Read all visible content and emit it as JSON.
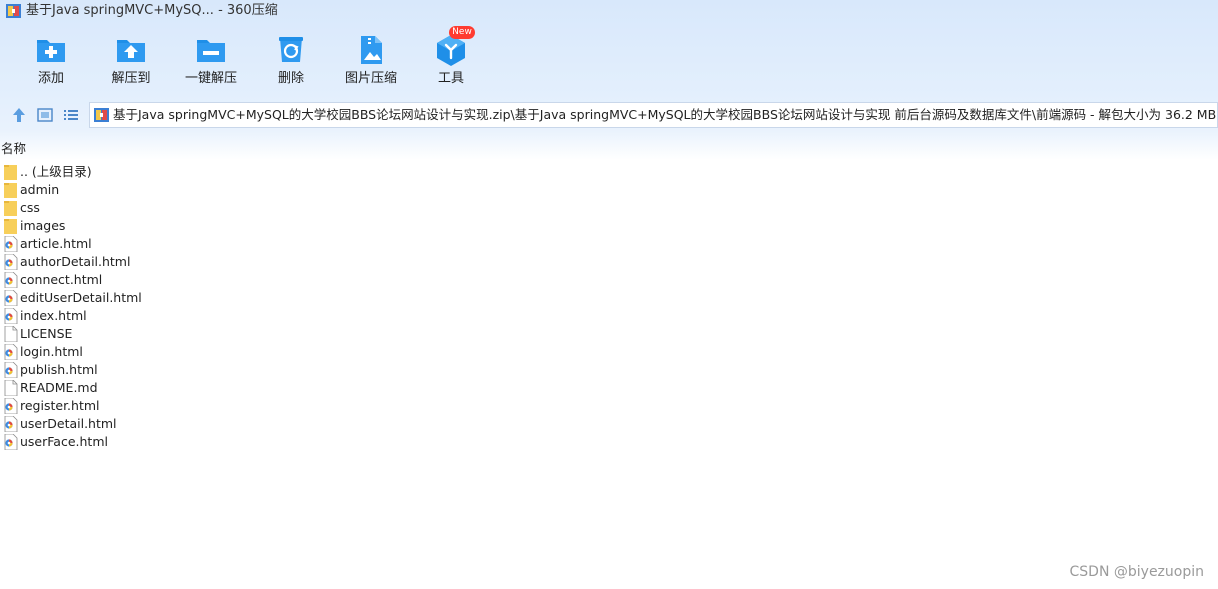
{
  "window": {
    "title": "基于Java springMVC+MySQ... - 360压缩"
  },
  "toolbar": {
    "items": [
      {
        "label": "添加",
        "icon": "add-folder-icon"
      },
      {
        "label": "解压到",
        "icon": "extract-to-icon"
      },
      {
        "label": "一键解压",
        "icon": "one-click-extract-icon"
      },
      {
        "label": "删除",
        "icon": "recycle-delete-icon"
      },
      {
        "label": "图片压缩",
        "icon": "image-compress-icon"
      },
      {
        "label": "工具",
        "icon": "tools-cube-icon",
        "badge": "New"
      }
    ]
  },
  "navigation": {
    "path": "基于Java springMVC+MySQL的大学校园BBS论坛网站设计与实现.zip\\基于Java springMVC+MySQL的大学校园BBS论坛网站设计与实现 前后台源码及数据库文件\\前端源码 - 解包大小为 36.2 MB"
  },
  "list": {
    "column_name": "名称",
    "items": [
      {
        "name": ".. (上级目录)",
        "type": "folder"
      },
      {
        "name": "admin",
        "type": "folder"
      },
      {
        "name": "css",
        "type": "folder"
      },
      {
        "name": "images",
        "type": "folder"
      },
      {
        "name": "article.html",
        "type": "html"
      },
      {
        "name": "authorDetail.html",
        "type": "html"
      },
      {
        "name": "connect.html",
        "type": "html"
      },
      {
        "name": "editUserDetail.html",
        "type": "html"
      },
      {
        "name": "index.html",
        "type": "html"
      },
      {
        "name": "LICENSE",
        "type": "file"
      },
      {
        "name": "login.html",
        "type": "html"
      },
      {
        "name": "publish.html",
        "type": "html"
      },
      {
        "name": "README.md",
        "type": "file"
      },
      {
        "name": "register.html",
        "type": "html"
      },
      {
        "name": "userDetail.html",
        "type": "html"
      },
      {
        "name": "userFace.html",
        "type": "html"
      }
    ]
  },
  "watermark": "CSDN @biyezuopin",
  "colors": {
    "accent": "#1f8fe8",
    "folder": "#f7cf5a",
    "badge": "#ff3b30"
  }
}
